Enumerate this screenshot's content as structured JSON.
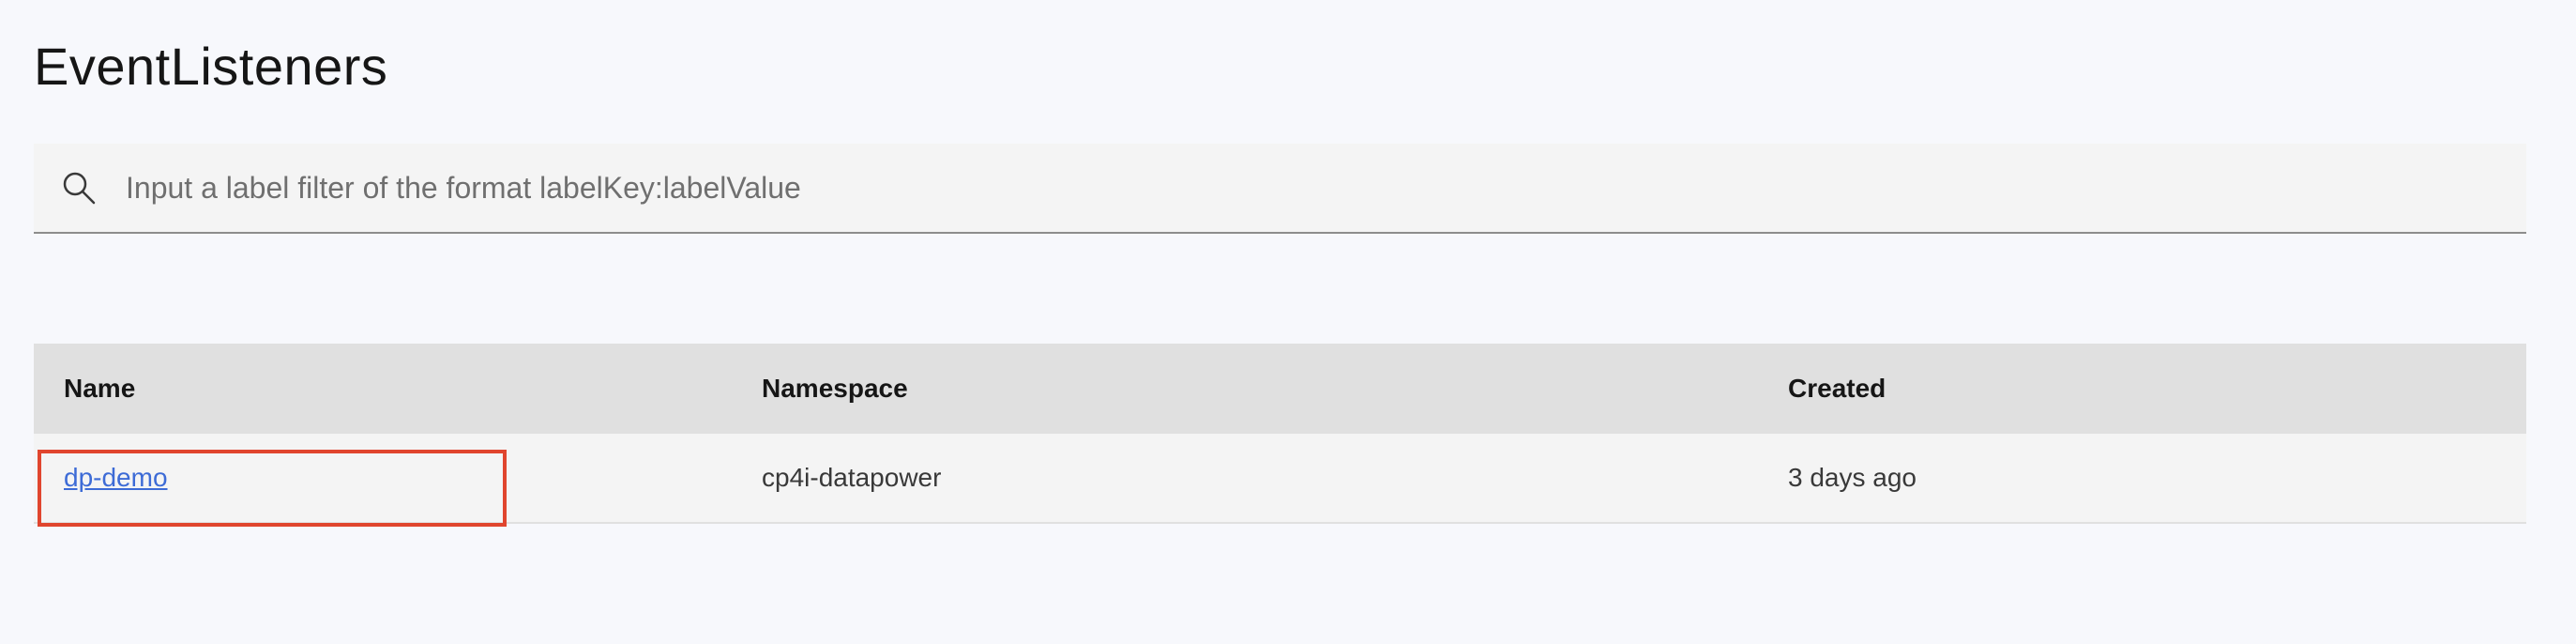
{
  "page": {
    "title": "EventListeners"
  },
  "search": {
    "placeholder": "Input a label filter of the format labelKey:labelValue",
    "value": "",
    "icon": "search-icon"
  },
  "table": {
    "columns": [
      "Name",
      "Namespace",
      "Created"
    ],
    "rows": [
      {
        "name": "dp-demo",
        "namespace": "cp4i-datapower",
        "created": "3 days ago"
      }
    ]
  },
  "colors": {
    "background": "#f7f8fc",
    "header_bg": "#e0e0e0",
    "row_bg": "#f4f4f4",
    "link": "#3d6bd6",
    "highlight": "#e0452e"
  }
}
